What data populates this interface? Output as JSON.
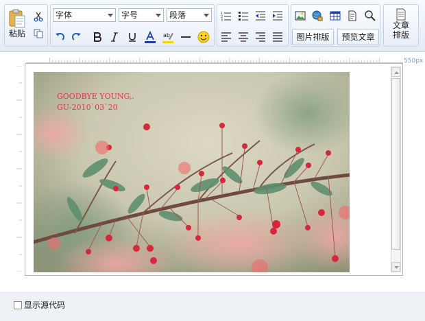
{
  "toolbar": {
    "paste_label": "粘贴",
    "font_family": {
      "value": "字体"
    },
    "font_size": {
      "value": "字号"
    },
    "paragraph": {
      "value": "段落"
    },
    "image_layout_label": "图片排版",
    "preview_label": "预览文章",
    "article_layout_label": "文章排版",
    "article_layout_lines": [
      "文章",
      "排版"
    ]
  },
  "editor": {
    "ruler_width_label": "550px",
    "photo_caption_line1": "GOODBYE YOUNG,.",
    "photo_caption_line2": "GU-2010`03`20"
  },
  "footer": {
    "show_source_label": "显示源代码",
    "show_source_checked": false
  },
  "colors": {
    "accent_blue": "#1f3fae",
    "highlight_yellow": "#f2d400",
    "caption_red": "#e0324a",
    "toolbar_border": "#c8d3e2"
  }
}
